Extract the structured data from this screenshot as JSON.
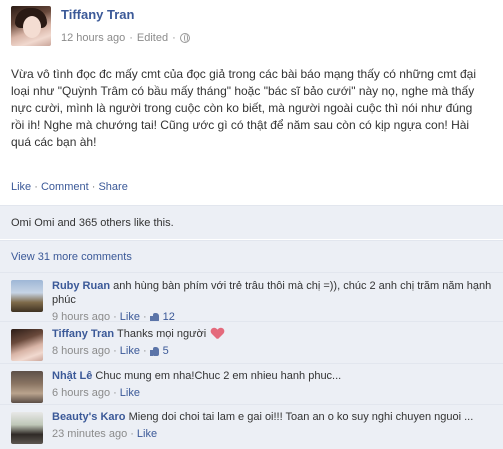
{
  "post": {
    "author": "Tiffany Tran",
    "time": "12 hours ago",
    "meta_sep": "·",
    "edited": "Edited",
    "meta_sep2": "·",
    "body": "Vừa vô tình đọc đc mấy cmt của đọc giả trong các bài báo mạng thấy có những cmt đại loại như \"Quỳnh Trâm có bầu mấy tháng\" hoặc \"bác sĩ bảo cưới\" này nọ, nghe mà thấy nực cười, mình là người trong cuộc còn ko biết, mà người ngoài cuộc thì nói như đúng rồi ih! Nghe mà chướng tai! Cũng ước gì có thật để năm sau còn có kịp ngựa con! Hài quá các bạn àh!",
    "actions": {
      "like": "Like",
      "sep": "·",
      "comment": "Comment",
      "share": "Share"
    },
    "likes_text": "Omi Omi and 365 others like this.",
    "more_comments": "View 31 more comments"
  },
  "comments": [
    {
      "name": "Ruby Ruan",
      "text": "anh hùng bàn phím với trẻ trâu thôi mà chị =)), chúc 2 anh chị trăm năm hạnh phúc",
      "time": "9 hours ago",
      "like": "Like",
      "sep": "·",
      "count": "12"
    },
    {
      "name": "Tiffany Tran",
      "text": "Thanks mọi người",
      "time": "8 hours ago",
      "like": "Like",
      "sep": "·",
      "count": "5"
    },
    {
      "name": "Nhật Lê",
      "text": "Chuc mung em nha!Chuc 2 em nhieu hanh phuc...",
      "time": "6 hours ago",
      "like": "Like",
      "sep": "·",
      "count": ""
    },
    {
      "name": "Beauty's Karo",
      "text": "Mieng doi choi tai lam e gai oi!!! Toan an o ko suy nghi chuyen nguoi ...",
      "time": "23 minutes ago",
      "like": "Like",
      "sep": "·",
      "count": ""
    }
  ],
  "icons": {
    "audience": "globe-icon",
    "like_count": "thumbs-up-icon",
    "emoji": "heart-icon"
  },
  "colors": {
    "link": "#3b5998",
    "meta": "#8b8b8b",
    "comment_bg": "#eceff5"
  }
}
